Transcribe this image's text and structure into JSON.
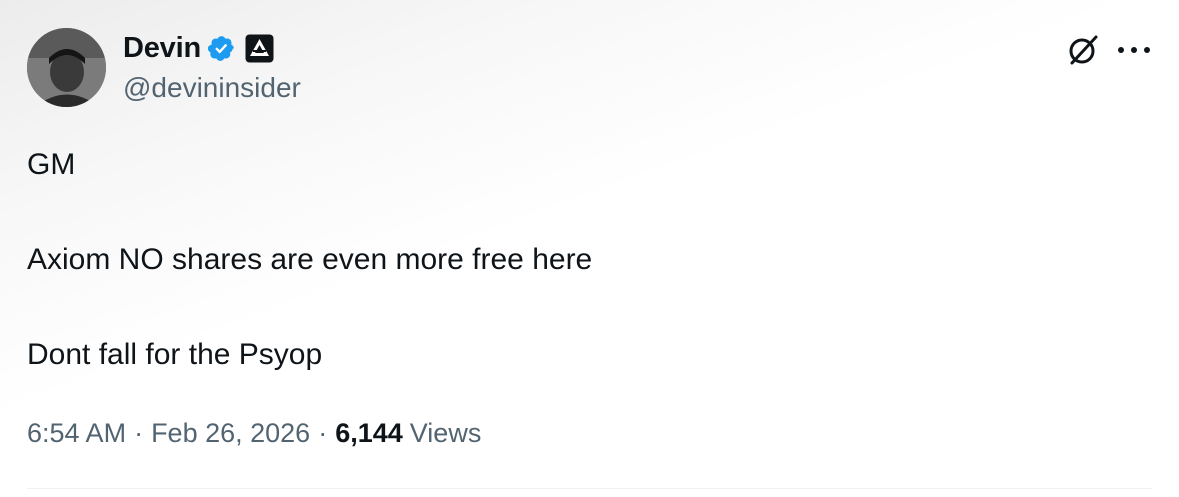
{
  "author": {
    "display_name": "Devin",
    "handle": "@devininsider",
    "verified": true,
    "affiliate_badge": "triangle-logo-icon"
  },
  "tweet": {
    "lines": [
      "GM",
      "Axiom NO shares are even more free here",
      "Dont fall for the Psyop"
    ]
  },
  "meta": {
    "time": "6:54 AM",
    "date": "Feb 26, 2026",
    "separator": "·",
    "views_count": "6,144",
    "views_label": "Views"
  },
  "icons": {
    "grok": "grok-icon",
    "more": "more-icon"
  },
  "colors": {
    "verified_blue": "#1d9bf0",
    "text_primary": "#0f1419",
    "text_secondary": "#536471"
  }
}
